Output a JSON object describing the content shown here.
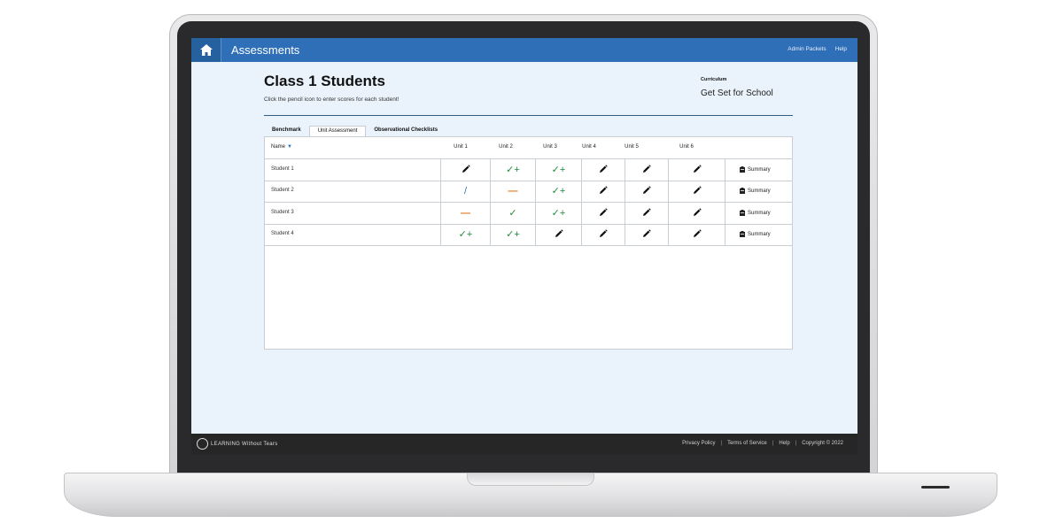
{
  "header": {
    "app_title": "Assessments",
    "links": [
      "Admin Packets",
      "Help"
    ]
  },
  "page": {
    "title": "Class 1 Students",
    "subtitle": "Click the pencil icon to enter scores for each student!",
    "curriculum_label": "Curriculum",
    "curriculum_value": "Get Set for School"
  },
  "tabs": [
    {
      "label": "Benchmark",
      "active": false
    },
    {
      "label": "Unit Assessment",
      "active": true
    },
    {
      "label": "Observational Checklists",
      "active": false
    }
  ],
  "table": {
    "name_header": "Name",
    "sort_indicator": "▼",
    "unit_headers": [
      "Unit 1",
      "Unit 2",
      "Unit 3",
      "Unit 4",
      "Unit 5",
      "Unit 6"
    ],
    "summary_label": "Summary",
    "rows": [
      {
        "name": "Student 1",
        "marks": [
          "pencil",
          "check-plus",
          "check-plus",
          "pencil",
          "pencil",
          "pencil"
        ]
      },
      {
        "name": "Student 2",
        "marks": [
          "slash",
          "dash",
          "check-plus",
          "pencil",
          "pencil",
          "pencil"
        ]
      },
      {
        "name": "Student 3",
        "marks": [
          "dash",
          "check",
          "check-plus",
          "pencil",
          "pencil",
          "pencil"
        ]
      },
      {
        "name": "Student 4",
        "marks": [
          "check-plus",
          "check-plus",
          "pencil",
          "pencil",
          "pencil",
          "pencil"
        ]
      }
    ]
  },
  "footer": {
    "logo_text": "LEARNING Without Tears",
    "links": [
      "Privacy Policy",
      "Terms of Service",
      "Help",
      "Copyright © 2022"
    ]
  },
  "colors": {
    "topbar": "#2f6fb7",
    "check": "#1f8a3a",
    "dash": "#e07a1f",
    "slash": "#2f6fb7"
  }
}
